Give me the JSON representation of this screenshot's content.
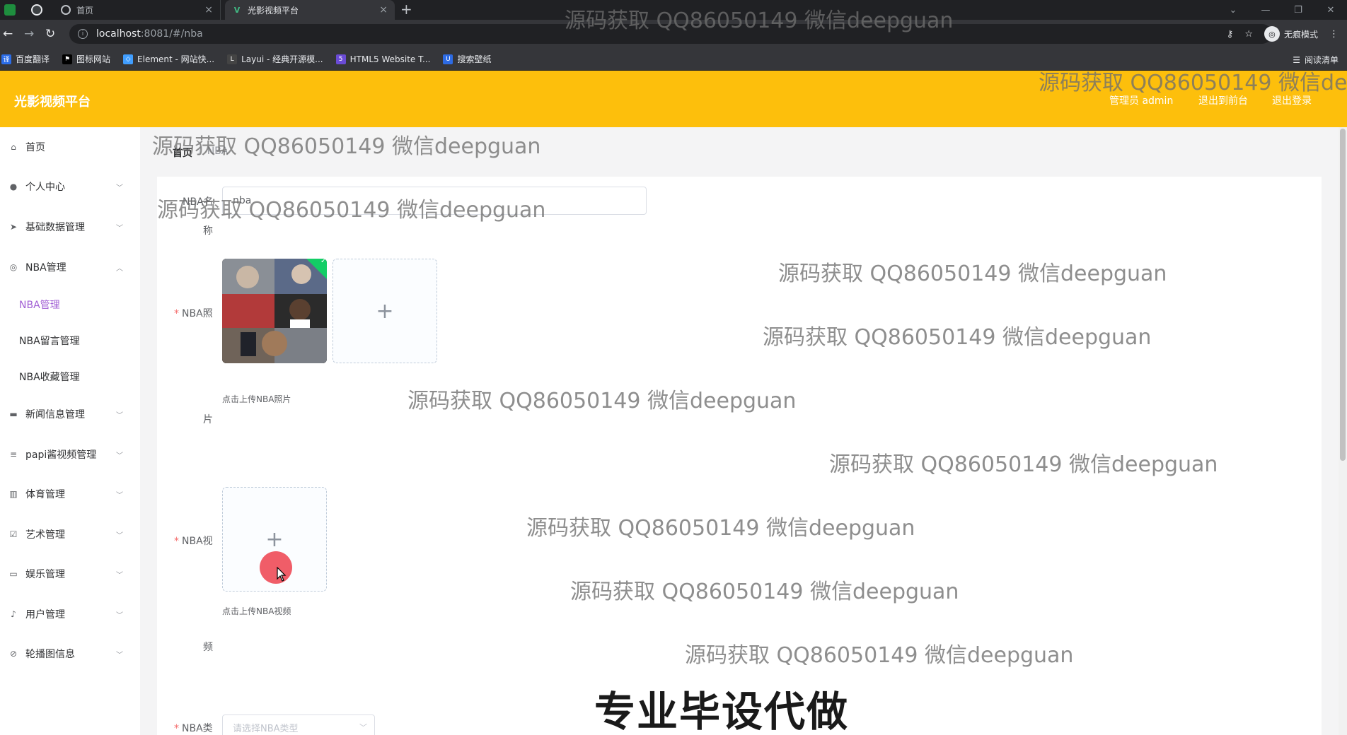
{
  "browser": {
    "tabs": [
      {
        "title": "首页",
        "close": "×"
      },
      {
        "title": "光影视频平台",
        "close": "×"
      }
    ],
    "new_tab": "+",
    "url_host": "localhost",
    "url_path": ":8081/#/nba",
    "incognito_label": "无痕模式",
    "bookmarks": [
      "百度翻译",
      "图标网站",
      "Element - 网站快...",
      "Layui - 经典开源模...",
      "HTML5 Website T...",
      "搜索壁纸"
    ],
    "reading_list": "阅读清单"
  },
  "header": {
    "brand": "光影视频平台",
    "links": [
      "管理员 admin",
      "退出到前台",
      "退出登录"
    ]
  },
  "sidebar": {
    "items": [
      {
        "label": "首页",
        "icon": "home-icon"
      },
      {
        "label": "个人中心",
        "icon": "user-icon"
      },
      {
        "label": "基础数据管理",
        "icon": "send-icon"
      },
      {
        "label": "NBA管理",
        "icon": "basketball-icon"
      },
      {
        "label": "新闻信息管理",
        "icon": "message-icon"
      },
      {
        "label": "papi酱视频管理",
        "icon": "menu-icon"
      },
      {
        "label": "体育管理",
        "icon": "data-icon"
      },
      {
        "label": "艺术管理",
        "icon": "checked-icon"
      },
      {
        "label": "娱乐管理",
        "icon": "chat-icon"
      },
      {
        "label": "用户管理",
        "icon": "microphone-icon"
      },
      {
        "label": "轮播图信息",
        "icon": "compass-icon"
      }
    ],
    "sub_items": [
      "NBA管理",
      "NBA留言管理",
      "NBA收藏管理"
    ]
  },
  "breadcrumb": {
    "home": "首页",
    "sep": "/",
    "current": "NBA"
  },
  "form": {
    "name_label_1": "NBA名",
    "name_label_2": "称",
    "name_value": "nba",
    "photo_label_1": "NBA照",
    "photo_label_2": "片",
    "photo_tip": "点击上传NBA照片",
    "video_label_1": "NBA视",
    "video_label_2": "频",
    "video_tip": "点击上传NBA视频",
    "type_label": "NBA类",
    "type_placeholder": "请选择NBA类型",
    "required_mark": "*",
    "plus": "+"
  },
  "overlays": {
    "watermark": "源码获取 QQ86050149 微信deepguan",
    "promo": "专业毕设代做"
  },
  "colors": {
    "header_bg": "#fdbf0c",
    "active_submenu": "#a15fd4",
    "required": "#f56c6c"
  }
}
